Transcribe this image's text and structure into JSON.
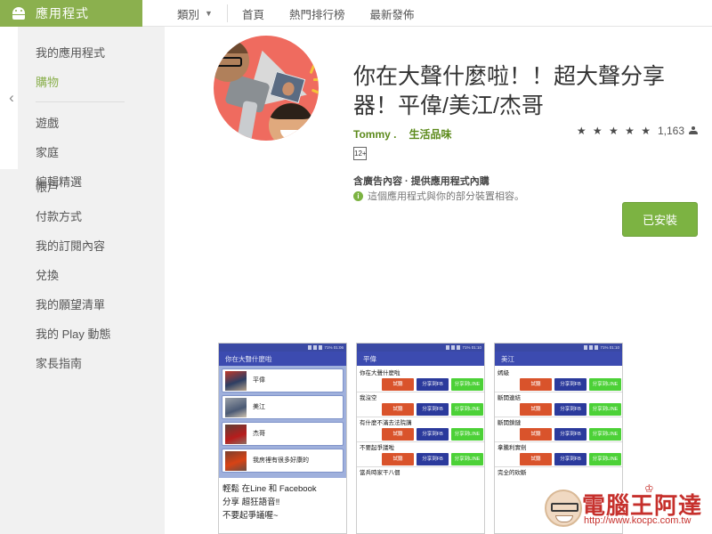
{
  "topbar": {
    "brand_label": "應用程式",
    "brand_icon": "android-robot-icon",
    "category_label": "類別",
    "category_chevron": "chevron-down-icon",
    "links": [
      "首頁",
      "熱門排行榜",
      "最新發佈"
    ]
  },
  "sidebar": {
    "collapse_icon": "‹",
    "top_items": [
      {
        "label": "我的應用程式",
        "active": false
      },
      {
        "label": "購物",
        "active": true
      }
    ],
    "group_items": [
      {
        "label": "遊戲"
      },
      {
        "label": "家庭"
      },
      {
        "label": "編輯精選"
      }
    ],
    "bottom_items": [
      {
        "label": "帳戶"
      },
      {
        "label": "付款方式"
      },
      {
        "label": "我的訂閱內容"
      },
      {
        "label": "兌換"
      },
      {
        "label": "我的願望清單"
      },
      {
        "label": "我的 Play 動態"
      },
      {
        "label": "家長指南"
      }
    ]
  },
  "app": {
    "icon_name": "megaphone-app-icon",
    "title": "你在大聲什麼啦！！超大聲分享器！平偉/美江/杰哥",
    "developer": "Tommy .",
    "category": "生活品味",
    "stars": "★ ★ ★ ★ ★",
    "rating_count": "1,163",
    "rating_person_icon": "person-icon",
    "content_rating_badge": "12+",
    "ads_note": "含廣告內容 · 提供應用程式內購",
    "info_icon": "info-icon",
    "compatibility_note": "這個應用程式與你的部分裝置相容。",
    "install_button_label": "已安裝",
    "install_button_color": "#7cb342",
    "icon_bg_color": "#ef6b5f"
  },
  "screenshots": [
    {
      "status_text": "71% 01:06",
      "header_title": "你在大聲什麼啦",
      "type": "list",
      "rows": [
        {
          "label": "平偉"
        },
        {
          "label": "美江"
        },
        {
          "label": "杰哥"
        },
        {
          "label": "我房裡有很多好康的"
        }
      ],
      "caption": [
        "輕鬆 在Line 和 Facebook",
        "分享 超狂語音‼",
        "不要起爭議喔~"
      ]
    },
    {
      "status_text": "71% 01:10",
      "header_title": "平偉",
      "type": "buttons",
      "button_labels": {
        "a": "試聽",
        "b": "分享到FB",
        "c": "分享到LINE"
      },
      "rows": [
        {
          "text": "你在大聲什麼啦"
        },
        {
          "text": "我沒空"
        },
        {
          "text": "有什麼不滿去法院講"
        },
        {
          "text": "不要起爭議啦"
        },
        {
          "text": "當兵時家干八個"
        }
      ]
    },
    {
      "status_text": "71% 01:10",
      "header_title": "美江",
      "type": "buttons",
      "button_labels": {
        "a": "試聽",
        "b": "分享到FB",
        "c": "分享到LINE"
      },
      "rows": [
        {
          "text": "嫣級"
        },
        {
          "text": "斷開連結"
        },
        {
          "text": "斷開鎖鏈"
        },
        {
          "text": "拿騰利實劍"
        },
        {
          "text": "完全的砍斷"
        }
      ]
    }
  ],
  "watermark": {
    "brand": "電腦王阿達",
    "crown_icon": "crown-icon",
    "url": "http://www.kocpc.com.tw",
    "color": "#c6302c"
  }
}
